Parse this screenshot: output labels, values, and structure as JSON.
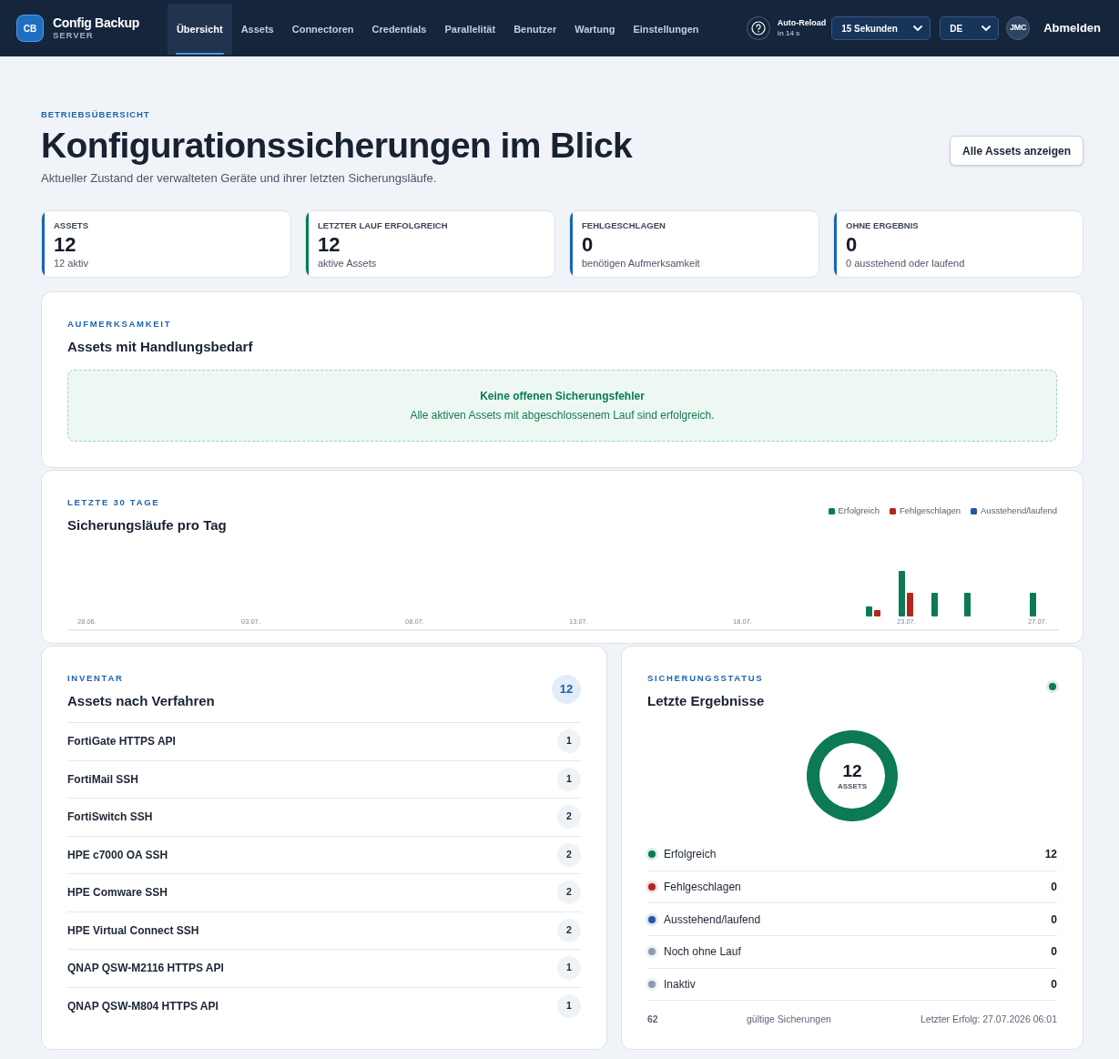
{
  "header": {
    "logo": "CB",
    "app_name": "Config Backup",
    "app_sub": "SERVER",
    "nav": [
      {
        "label": "Übersicht",
        "selected": true
      },
      {
        "label": "Assets",
        "selected": false
      },
      {
        "label": "Connectoren",
        "selected": false
      },
      {
        "label": "Credentials",
        "selected": false
      },
      {
        "label": "Parallelität",
        "selected": false
      },
      {
        "label": "Benutzer",
        "selected": false
      },
      {
        "label": "Wartung",
        "selected": false
      },
      {
        "label": "Einstellungen",
        "selected": false
      }
    ],
    "auto_reload": {
      "label": "Auto-Reload",
      "countdown": "in 14 s",
      "interval": "15 Sekunden"
    },
    "language": "DE",
    "avatar": "JMC",
    "logout": "Abmelden"
  },
  "page": {
    "eyebrow": "BETRIEBSÜBERSICHT",
    "title": "Konfigurationssicherungen im Blick",
    "subtitle": "Aktueller Zustand der verwalteten Geräte und ihrer letzten Sicherungsläufe.",
    "button": "Alle Assets anzeigen"
  },
  "stats": [
    {
      "label": "ASSETS",
      "value": "12",
      "note": "12 aktiv",
      "color": "#1866b0"
    },
    {
      "label": "LETZTER LAUF ERFOLGREICH",
      "value": "12",
      "note": "aktive Assets",
      "color": "#0b7a55"
    },
    {
      "label": "FEHLGESCHLAGEN",
      "value": "0",
      "note": "benötigen Aufmerksamkeit",
      "color": "#1866b0"
    },
    {
      "label": "OHNE ERGEBNIS",
      "value": "0",
      "note": "0 ausstehend oder laufend",
      "color": "#1866b0"
    }
  ],
  "attention": {
    "eyebrow": "AUFMERKSAMKEIT",
    "title": "Assets mit Handlungsbedarf",
    "empty_title": "Keine offenen Sicherungsfehler",
    "empty_text": "Alle aktiven Assets mit abgeschlossenem Lauf sind erfolgreich."
  },
  "runs": {
    "eyebrow": "LETZTE 30 TAGE",
    "title": "Sicherungsläufe pro Tag",
    "legend": [
      {
        "label": "Erfolgreich",
        "color": "#0b7a55"
      },
      {
        "label": "Fehlgeschlagen",
        "color": "#b3261e"
      },
      {
        "label": "Ausstehend/laufend",
        "color": "#2456a6"
      }
    ],
    "x_labels": [
      "28.06.",
      "03.07.",
      "08.07.",
      "13.07.",
      "18.07.",
      "23.07.",
      "27.07."
    ]
  },
  "inventory": {
    "eyebrow": "INVENTAR",
    "title": "Assets nach Verfahren",
    "total": "12",
    "rows": [
      {
        "name": "FortiGate HTTPS API",
        "count": "1"
      },
      {
        "name": "FortiMail SSH",
        "count": "1"
      },
      {
        "name": "FortiSwitch SSH",
        "count": "2"
      },
      {
        "name": "HPE c7000 OA SSH",
        "count": "2"
      },
      {
        "name": "HPE Comware SSH",
        "count": "2"
      },
      {
        "name": "HPE Virtual Connect SSH",
        "count": "2"
      },
      {
        "name": "QNAP QSW-M2116 HTTPS API",
        "count": "1"
      },
      {
        "name": "QNAP QSW-M804 HTTPS API",
        "count": "1"
      }
    ]
  },
  "status": {
    "eyebrow": "SICHERUNGSSTATUS",
    "title": "Letzte Ergebnisse",
    "healthy": true,
    "center_value": "12",
    "center_label": "ASSETS",
    "items": [
      {
        "label": "Erfolgreich",
        "value": "12",
        "color": "#0b7a55"
      },
      {
        "label": "Fehlgeschlagen",
        "value": "0",
        "color": "#b3261e"
      },
      {
        "label": "Ausstehend/laufend",
        "value": "0",
        "color": "#2456a6"
      },
      {
        "label": "Noch ohne Lauf",
        "value": "0",
        "color": "#8e99aa"
      },
      {
        "label": "Inaktiv",
        "value": "0",
        "color": "#8e99aa"
      }
    ],
    "footer": {
      "count": "62",
      "label": "gültige Sicherungen",
      "last_success": "Letzter Erfolg: 27.07.2026 06:01"
    }
  }
}
